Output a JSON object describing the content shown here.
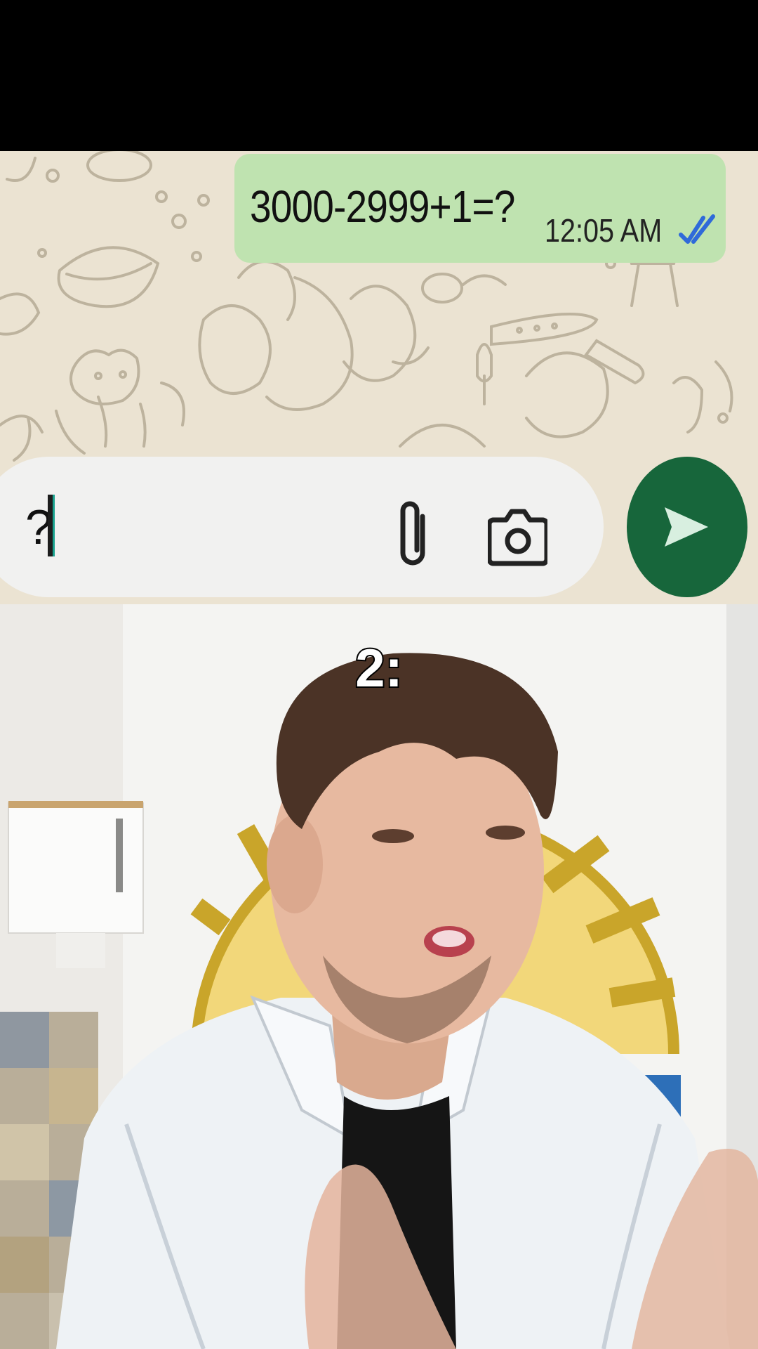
{
  "chat": {
    "message_text": "3000-2999+1=?",
    "message_time": "12:05 AM",
    "input_value": "?",
    "icons": {
      "attach": "paperclip-icon",
      "camera": "camera-icon",
      "send": "send-icon",
      "read_receipt": "double-check-icon"
    },
    "colors": {
      "bubble": "#bfe3b0",
      "send_button": "#17663b",
      "read_receipt": "#2f6ad9",
      "wallpaper": "#ebe3d2"
    }
  },
  "video": {
    "caption": "2:"
  }
}
